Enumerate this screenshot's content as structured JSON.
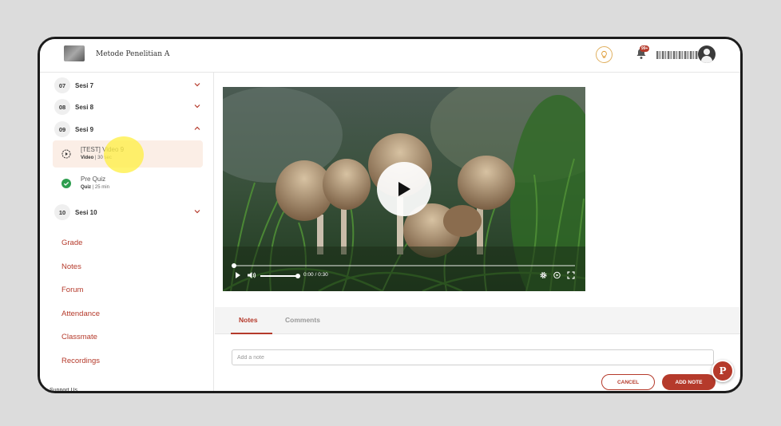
{
  "header": {
    "course_title": "Metode Penelitian A",
    "notification_count": "99+"
  },
  "sidebar": {
    "sessions": [
      {
        "num": "07",
        "label": "Sesi 7",
        "expanded": false
      },
      {
        "num": "08",
        "label": "Sesi 8",
        "expanded": false
      },
      {
        "num": "09",
        "label": "Sesi 9",
        "expanded": true
      },
      {
        "num": "10",
        "label": "Sesi 10",
        "expanded": false
      }
    ],
    "lessons": [
      {
        "title": "[TEST] Video 9",
        "type": "Video",
        "detail": "30 sec",
        "icon": "play-circle-icon",
        "active": true
      },
      {
        "title": "Pre Quiz",
        "type": "Quiz",
        "detail": "25 min",
        "icon": "check-circle-icon",
        "active": false
      }
    ],
    "menu": [
      "Grade",
      "Notes",
      "Forum",
      "Attendance",
      "Classmate",
      "Recordings"
    ],
    "support": "Support Us"
  },
  "video": {
    "time": "0:00 / 0:30",
    "progress": 0.0
  },
  "notes_panel": {
    "tabs": [
      "Notes",
      "Comments"
    ],
    "active_tab": "Notes",
    "input_placeholder": "Add a note",
    "cancel_label": "CANCEL",
    "add_label": "ADD NOTE"
  },
  "fab_label": "P",
  "colors": {
    "accent": "#b53a2b",
    "active_lesson_bg": "#fbeee6",
    "complete_green": "#2e9e4f"
  }
}
